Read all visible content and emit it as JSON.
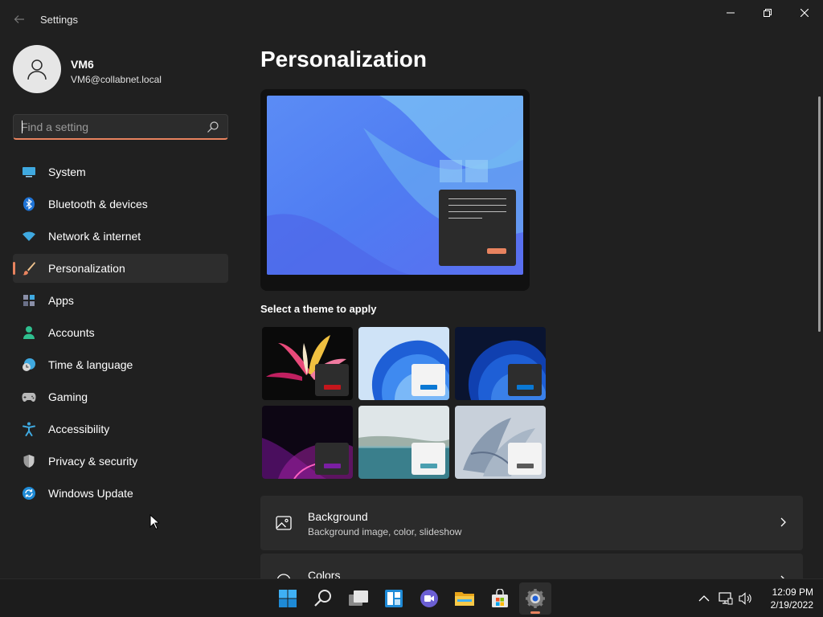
{
  "window": {
    "app_title": "Settings"
  },
  "profile": {
    "name": "VM6",
    "email": "VM6@collabnet.local"
  },
  "search": {
    "placeholder": "Find a setting"
  },
  "sidebar": {
    "items": [
      {
        "label": "System",
        "icon": "system-icon"
      },
      {
        "label": "Bluetooth & devices",
        "icon": "bluetooth-icon"
      },
      {
        "label": "Network & internet",
        "icon": "wifi-icon"
      },
      {
        "label": "Personalization",
        "icon": "paintbrush-icon",
        "active": true
      },
      {
        "label": "Apps",
        "icon": "apps-icon"
      },
      {
        "label": "Accounts",
        "icon": "person-icon"
      },
      {
        "label": "Time & language",
        "icon": "clock-globe-icon"
      },
      {
        "label": "Gaming",
        "icon": "gamepad-icon"
      },
      {
        "label": "Accessibility",
        "icon": "accessibility-icon"
      },
      {
        "label": "Privacy & security",
        "icon": "shield-icon"
      },
      {
        "label": "Windows Update",
        "icon": "update-icon"
      }
    ]
  },
  "main": {
    "title": "Personalization",
    "theme_section_label": "Select a theme to apply",
    "themes": [
      {
        "name": "glow-theme",
        "accent": "#c4161c"
      },
      {
        "name": "windows-light-theme",
        "accent": "#0a78d4"
      },
      {
        "name": "windows-dark-theme",
        "accent": "#0a78d4"
      },
      {
        "name": "captured-motion-theme",
        "accent": "#7a1fa2"
      },
      {
        "name": "sunrise-theme",
        "accent": "#4a9fb0"
      },
      {
        "name": "flow-theme",
        "accent": "#5a5a5a"
      }
    ],
    "cards": [
      {
        "title": "Background",
        "subtitle": "Background image, color, slideshow"
      },
      {
        "title": "Colors",
        "subtitle": ""
      }
    ]
  },
  "taskbar": {
    "apps": [
      "start-icon",
      "search-icon",
      "task-view-icon",
      "widgets-icon",
      "teams-chat-icon",
      "file-explorer-icon",
      "store-icon",
      "settings-icon"
    ],
    "time": "12:09 PM",
    "date": "2/19/2022"
  },
  "colors": {
    "accent": "#e8835f",
    "background": "#202020",
    "card": "#2b2b2b"
  }
}
